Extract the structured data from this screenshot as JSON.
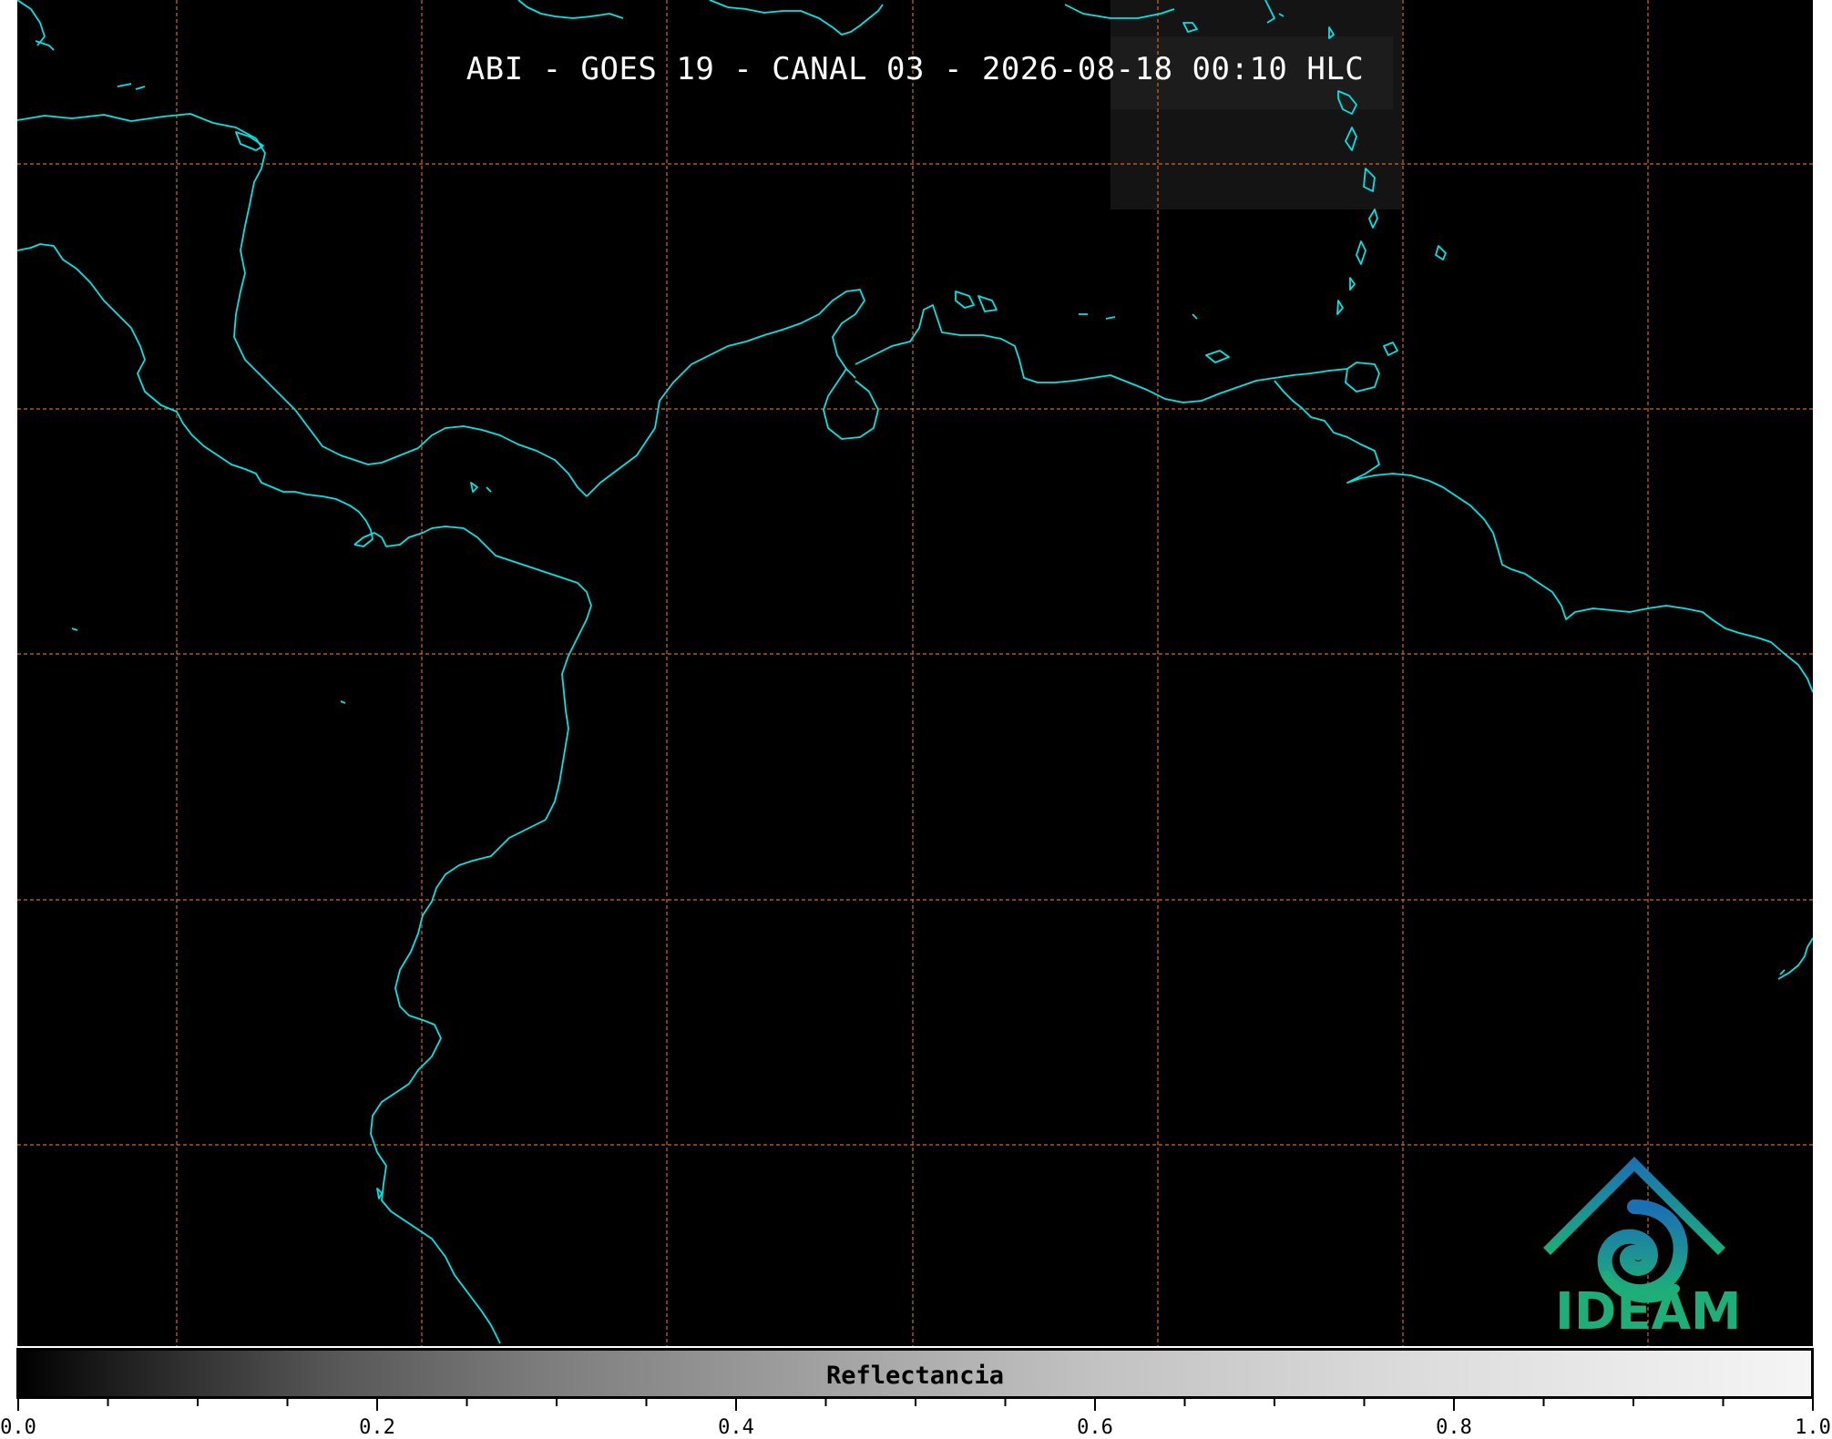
{
  "map": {
    "title": "ABI - GOES 19 - CANAL 03 - 2026-08-18 00:10 HLC",
    "background_color": "#000000",
    "coastline_color": "#00e5e5",
    "gridline_color": "#d2691e",
    "gridline_style": "dashed"
  },
  "colorbar": {
    "label": "Reflectancia",
    "min": 0.0,
    "max": 1.0,
    "tick_labels": [
      "0.0",
      "0.2",
      "0.4",
      "0.6",
      "0.8",
      "1.0"
    ],
    "colormap": "grayscale"
  },
  "logo": {
    "text": "IDEAM",
    "icon": "ideam-mountain-spiral-icon",
    "color": "#1fae7a"
  }
}
